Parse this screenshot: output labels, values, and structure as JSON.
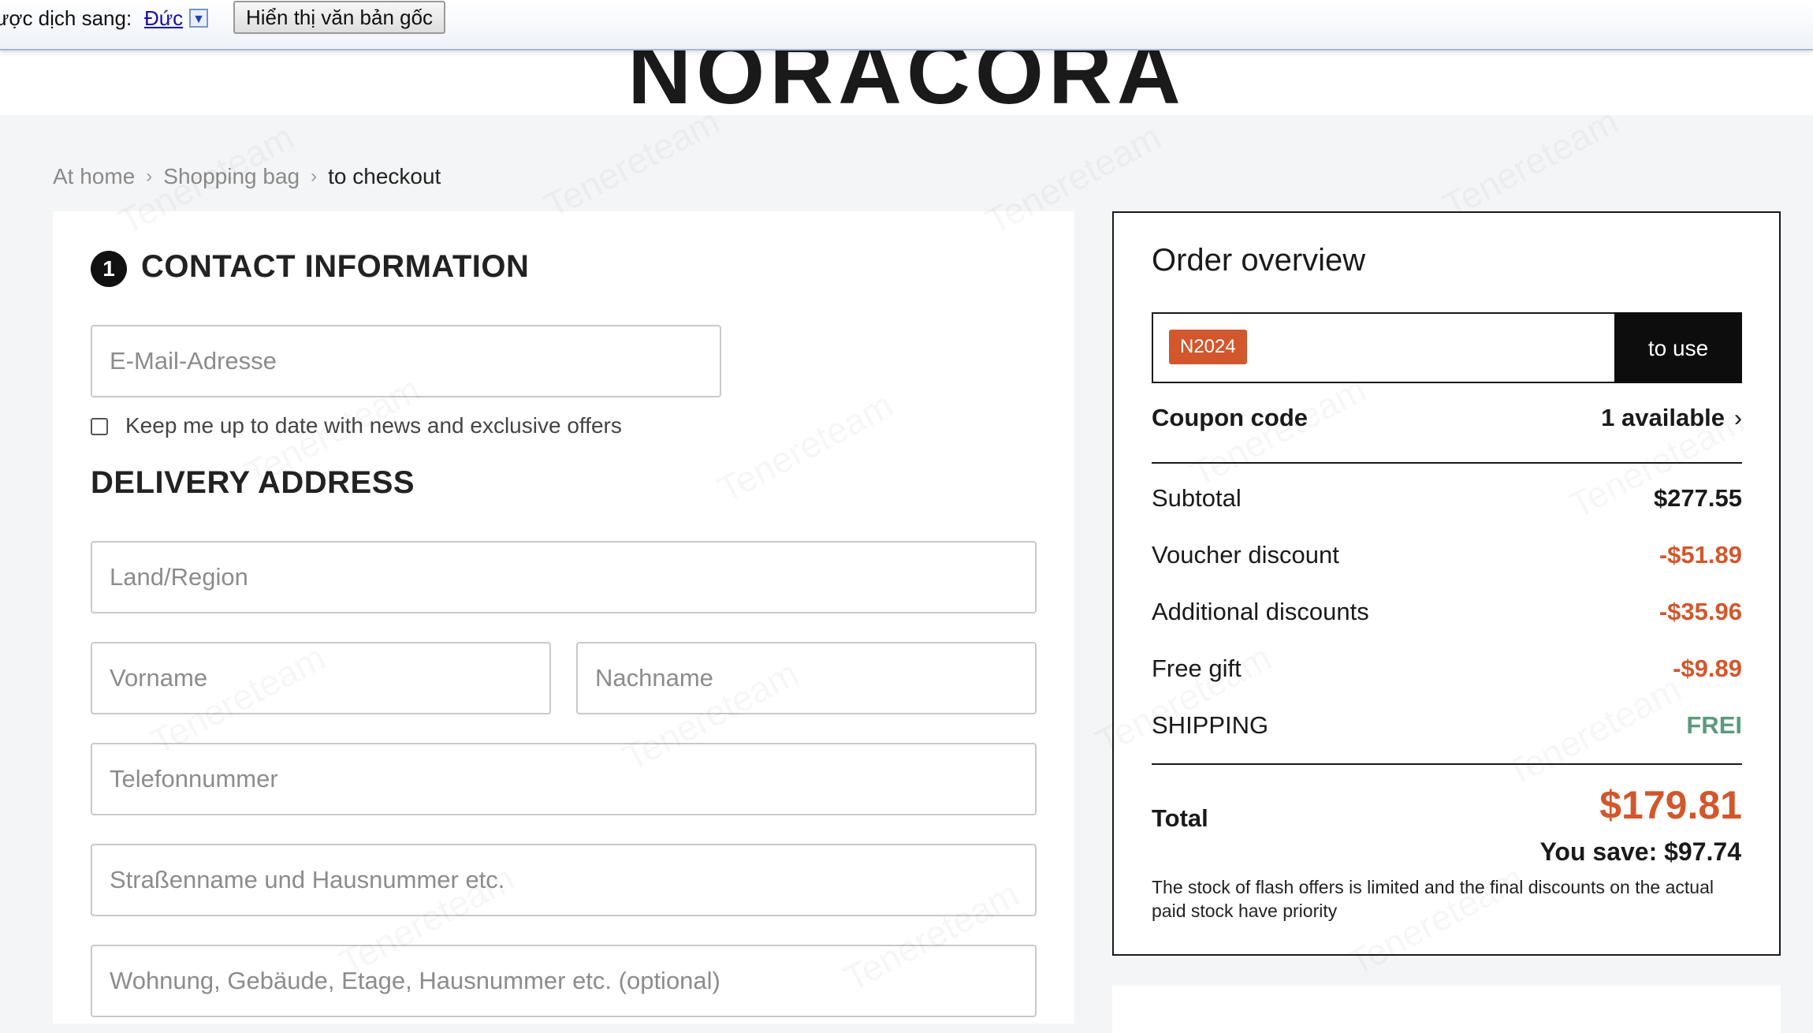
{
  "translate_bar": {
    "label": "ược dịch sang:",
    "language": "Đức",
    "dropdown_glyph": "▼",
    "show_original": "Hiển thị văn bản gốc"
  },
  "header": {
    "logo": "NORACORA"
  },
  "breadcrumb": {
    "items": [
      "At home",
      "Shopping bag",
      "to checkout"
    ],
    "separator_icon": "chevron-right-icon"
  },
  "contact": {
    "step": "1",
    "title": "CONTACT INFORMATION",
    "email_placeholder": "E-Mail-Adresse",
    "newsletter_label": "Keep me up to date with news and exclusive offers"
  },
  "delivery": {
    "title": "DELIVERY ADDRESS",
    "country_placeholder": "Land/Region",
    "firstname_placeholder": "Vorname",
    "lastname_placeholder": "Nachname",
    "phone_placeholder": "Telefonnummer",
    "street_placeholder": "Straßenname und Hausnummer etc.",
    "apartment_placeholder": "Wohnung, Gebäude, Etage, Hausnummer etc. (optional)"
  },
  "order": {
    "title": "Order overview",
    "coupon_applied": "N2024",
    "use_button": "to use",
    "coupon_label": "Coupon code",
    "coupon_available": "1 available",
    "subtotal_label": "Subtotal",
    "subtotal": "$277.55",
    "voucher_label": "Voucher discount",
    "voucher": "-$51.89",
    "additional_label": "Additional discounts",
    "additional": "-$35.96",
    "gift_label": "Free gift",
    "gift": "-$9.89",
    "shipping_label": "SHIPPING",
    "shipping": "FREI",
    "total_label": "Total",
    "total": "$179.81",
    "savings": "You save: $97.74",
    "note": "The stock of flash offers is limited and the final discounts on the actual paid stock have priority"
  },
  "colors": {
    "accent": "#d2572c",
    "free": "#5b9a7d",
    "dark": "#0d0d0d"
  },
  "watermark": "Tenereteam"
}
